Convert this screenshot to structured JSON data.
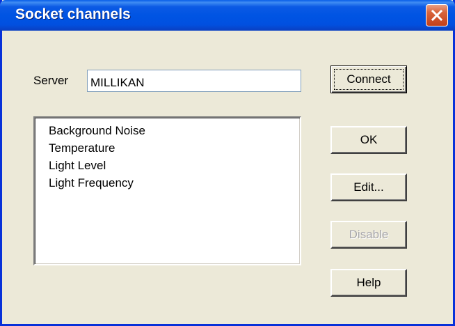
{
  "window": {
    "title": "Socket channels"
  },
  "server": {
    "label": "Server",
    "value": "MILLIKAN"
  },
  "channels": [
    "Background Noise",
    "Temperature",
    "Light Level",
    "Light Frequency"
  ],
  "buttons": {
    "connect": "Connect",
    "ok": "OK",
    "edit": "Edit...",
    "disable": "Disable",
    "help": "Help"
  },
  "colors": {
    "titlebar": "#0054e3",
    "dialog_bg": "#ece9d8",
    "close_button": "#d9653c",
    "disabled_text": "#a7a6aa"
  }
}
